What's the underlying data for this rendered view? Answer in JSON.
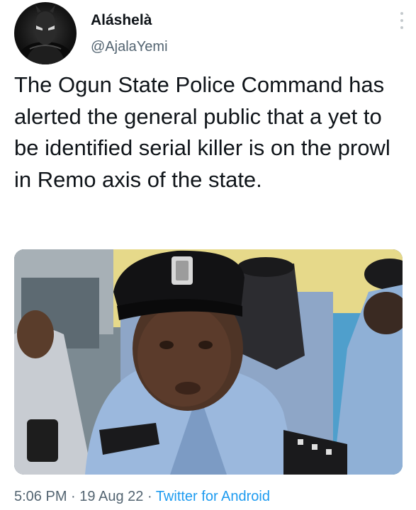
{
  "tweet": {
    "display_name": "Aláshelà",
    "handle": "@AjalaYemi",
    "text": "The Ogun State Police Command has alerted the general public that a yet to be identified serial killer is on the prowl in Remo axis of the state.",
    "time": "5:06 PM",
    "separator": "·",
    "date": "19 Aug 22",
    "source": "Twitter for Android"
  },
  "icons": {
    "more": "more-vertical-icon",
    "avatar": "masked-hero-avatar"
  },
  "colors": {
    "text": "#0f1419",
    "secondary": "#536471",
    "link": "#1d9bf0"
  }
}
